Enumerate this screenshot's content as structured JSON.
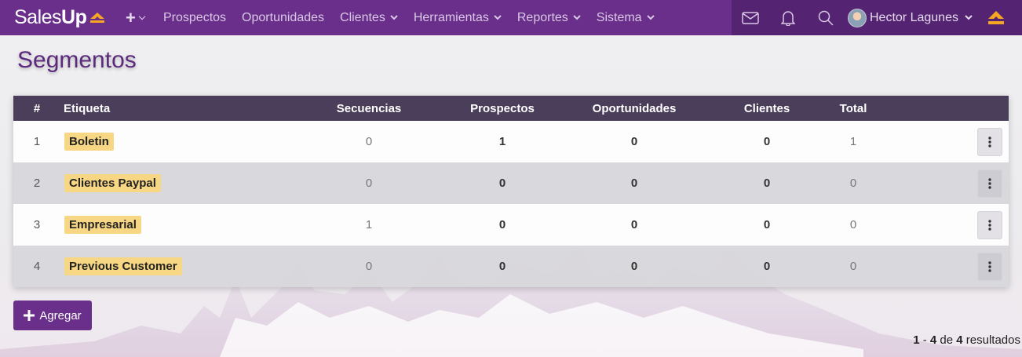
{
  "navbar": {
    "brand_part1": "Sales",
    "brand_part2": "Up",
    "plus_label": "+",
    "items": [
      {
        "label": "Prospectos",
        "dropdown": false
      },
      {
        "label": "Oportunidades",
        "dropdown": false
      },
      {
        "label": "Clientes",
        "dropdown": true
      },
      {
        "label": "Herramientas",
        "dropdown": true
      },
      {
        "label": "Reportes",
        "dropdown": true
      },
      {
        "label": "Sistema",
        "dropdown": true
      }
    ],
    "icons": [
      "mail-icon",
      "bell-icon",
      "search-icon"
    ],
    "user_name": "Hector Lagunes"
  },
  "page": {
    "title": "Segmentos"
  },
  "table": {
    "headers": {
      "num": "#",
      "label": "Etiqueta",
      "seq": "Secuencias",
      "pro": "Prospectos",
      "opo": "Oportunidades",
      "cli": "Clientes",
      "tot": "Total"
    },
    "rows": [
      {
        "num": "1",
        "label": "Boletin",
        "seq": "0",
        "pro": "1",
        "opo": "0",
        "cli": "0",
        "tot": "1"
      },
      {
        "num": "2",
        "label": "Clientes Paypal",
        "seq": "0",
        "pro": "0",
        "opo": "0",
        "cli": "0",
        "tot": "0"
      },
      {
        "num": "3",
        "label": "Empresarial",
        "seq": "1",
        "pro": "0",
        "opo": "0",
        "cli": "0",
        "tot": "0"
      },
      {
        "num": "4",
        "label": "Previous Customer",
        "seq": "0",
        "pro": "0",
        "opo": "0",
        "cli": "0",
        "tot": "0"
      }
    ]
  },
  "actions": {
    "add_label": "Agregar"
  },
  "pagination": {
    "from": "1",
    "sep": "-",
    "to": "4",
    "of": "de",
    "total": "4",
    "suffix": "resultados"
  },
  "colors": {
    "brand": "#6a2f8a",
    "brand_dark": "#542371",
    "header": "#4a3e5a",
    "tag": "#f7d783",
    "accent": "#f5a623"
  }
}
